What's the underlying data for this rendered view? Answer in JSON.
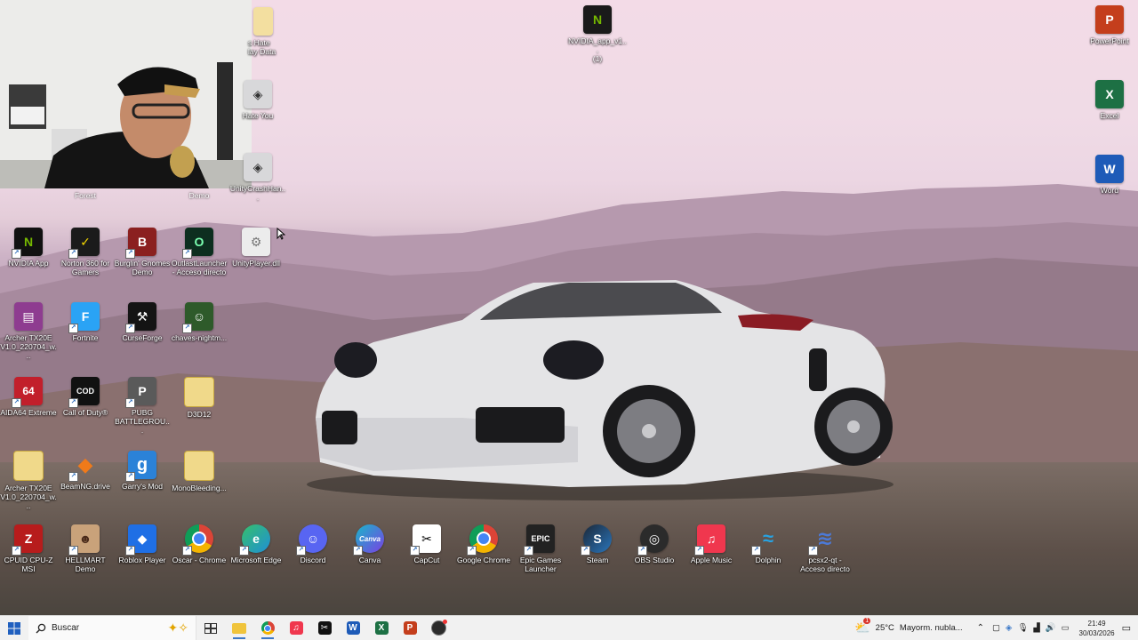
{
  "desktop": {
    "icons_top_right": [
      {
        "id": "powerpoint",
        "label": "PowerPoint",
        "color": "#c43e1c",
        "glyph": "P"
      },
      {
        "id": "excel",
        "label": "Excel",
        "color": "#1d7044",
        "glyph": "X"
      },
      {
        "id": "word",
        "label": "Word",
        "color": "#1e5bb8",
        "glyph": "W"
      }
    ],
    "icon_nvidia_top": {
      "label": "NVIDIA_app_v1...\n(1)"
    },
    "partial_labels_under_webcam": {
      "hate_data": "s Hate\nlay Data",
      "hate_you": "Hate You",
      "forest": "Forest",
      "demo": "Demo",
      "crash": "UnityCrashHan..."
    },
    "row1": [
      {
        "label": "NVIDIA App",
        "color": "#111111",
        "glyph": "N"
      },
      {
        "label": "Norton 360 for\nGamers",
        "color": "#1b1b1b",
        "glyph": "✓"
      },
      {
        "label": "Burglin' Gnomes\nDemo",
        "color": "#8b2020",
        "glyph": "B"
      },
      {
        "label": "OutlastLauncher\n- Acceso directo",
        "color": "#0d2e1f",
        "glyph": "O"
      },
      {
        "label": "UnityPlayer.dll",
        "color": "#e8e8e8",
        "glyph": "⚙"
      }
    ],
    "row2": [
      {
        "label": "Archer TX20E\nV1.0_220704_w...",
        "color": "#8e3c90",
        "glyph": "▤"
      },
      {
        "label": "Fortnite",
        "color": "#2aa3f5",
        "glyph": "F"
      },
      {
        "label": "CurseForge",
        "color": "#141414",
        "glyph": "⚒"
      },
      {
        "label": "chaves-nightm...",
        "color": "#2e5a2a",
        "glyph": "☺"
      }
    ],
    "row3": [
      {
        "label": "AIDA64 Extreme",
        "color": "#c21f2b",
        "glyph": "64"
      },
      {
        "label": "Call of Duty®",
        "color": "#111111",
        "glyph": "COD"
      },
      {
        "label": "PUBG\nBATTLEGROU...",
        "color": "#5a5a5a",
        "glyph": "P"
      },
      {
        "label": "D3D12",
        "color": "#e8c860",
        "glyph": ""
      }
    ],
    "row4": [
      {
        "label": "Archer TX20E\nV1.0_220704_w...",
        "color": "#e8c860",
        "glyph": ""
      },
      {
        "label": "BeamNG.drive",
        "color": "#f07a1a",
        "glyph": "◆"
      },
      {
        "label": "Garry's Mod",
        "color": "#2b82d8",
        "glyph": "g"
      },
      {
        "label": "MonoBleeding...",
        "color": "#e8c860",
        "glyph": ""
      }
    ],
    "row5": [
      {
        "label": "CPUID CPU-Z\nMSI",
        "color": "#b71c1c",
        "glyph": "Z"
      },
      {
        "label": "HELLMART\nDemo",
        "color": "#c9a27a",
        "glyph": "☻"
      },
      {
        "label": "Roblox Player",
        "color": "#1f6fe5",
        "glyph": "◆"
      },
      {
        "label": "Oscar - Chrome",
        "color": "#ffffff",
        "glyph": "◉"
      },
      {
        "label": "Microsoft Edge",
        "color": "#1f8fd6",
        "glyph": "e"
      },
      {
        "label": "Discord",
        "color": "#5865f2",
        "glyph": "☺"
      },
      {
        "label": "Canva",
        "color": "#19b7c9",
        "glyph": "Canva"
      },
      {
        "label": "CapCut",
        "color": "#ffffff",
        "glyph": "✂"
      },
      {
        "label": "Google Chrome",
        "color": "#ffffff",
        "glyph": "◉"
      },
      {
        "label": "Epic Games\nLauncher",
        "color": "#222222",
        "glyph": "EPIC"
      },
      {
        "label": "Steam",
        "color": "#1b2838",
        "glyph": "S"
      },
      {
        "label": "OBS Studio",
        "color": "#2b2b2b",
        "glyph": "◎"
      },
      {
        "label": "Apple Music",
        "color": "#f0374e",
        "glyph": "♫"
      },
      {
        "label": "Dolphin",
        "color": "#27a3e3",
        "glyph": "≈"
      },
      {
        "label": "pcsx2-qt -\nAcceso directo",
        "color": "#2a5fc0",
        "glyph": "≋"
      }
    ]
  },
  "taskbar": {
    "search_placeholder": "Buscar",
    "weather_temp": "25°C",
    "weather_text": "Mayorm. nubla...",
    "time": "21:49",
    "date": "30/03/2026",
    "weather_badge": "1"
  },
  "colors": {
    "taskbar_bg": "#f1f1f1",
    "accent": "#3b78c7"
  }
}
